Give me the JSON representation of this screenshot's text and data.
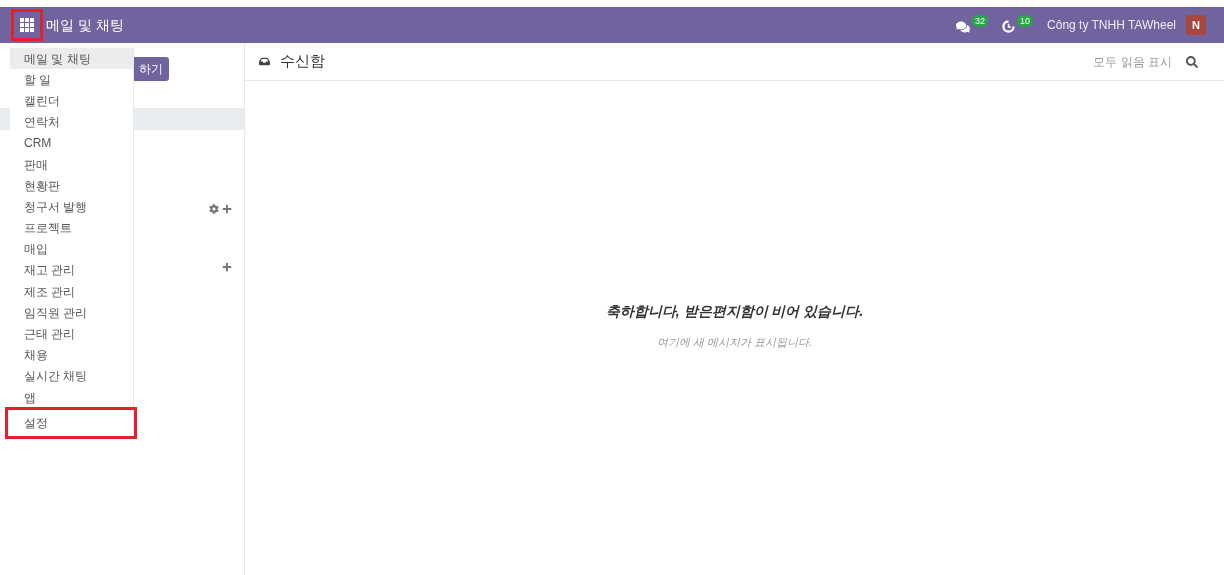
{
  "navbar": {
    "app_title": "메일 및 채팅",
    "apps_button_highlighted": true,
    "messages_count": "32",
    "activities_count": "10",
    "company": "Công ty TNHH TAWheel",
    "avatar_letter": "N"
  },
  "app_menu": [
    {
      "label": "메일 및 채팅",
      "selected": true,
      "highlighted": false
    },
    {
      "label": "할 일",
      "selected": false,
      "highlighted": false
    },
    {
      "label": "캘린더",
      "selected": false,
      "highlighted": false
    },
    {
      "label": "연락처",
      "selected": false,
      "highlighted": false
    },
    {
      "label": "CRM",
      "selected": false,
      "highlighted": false
    },
    {
      "label": "판매",
      "selected": false,
      "highlighted": false
    },
    {
      "label": "현황판",
      "selected": false,
      "highlighted": false
    },
    {
      "label": "청구서 발행",
      "selected": false,
      "highlighted": false
    },
    {
      "label": "프로젝트",
      "selected": false,
      "highlighted": false
    },
    {
      "label": "매입",
      "selected": false,
      "highlighted": false
    },
    {
      "label": "재고 관리",
      "selected": false,
      "highlighted": false
    },
    {
      "label": "제조 관리",
      "selected": false,
      "highlighted": false
    },
    {
      "label": "임직원 관리",
      "selected": false,
      "highlighted": false
    },
    {
      "label": "근태 관리",
      "selected": false,
      "highlighted": false
    },
    {
      "label": "채용",
      "selected": false,
      "highlighted": false
    },
    {
      "label": "실시간 채팅",
      "selected": false,
      "highlighted": false
    },
    {
      "label": "앱",
      "selected": false,
      "highlighted": false
    },
    {
      "label": "설정",
      "selected": false,
      "highlighted": true
    }
  ],
  "sidebar": {
    "compose_button": "하기"
  },
  "inbox": {
    "title": "수신함",
    "mark_all_read": "모두 읽음 표시",
    "empty_title": "축하합니다, 받은편지함이 비어 있습니다.",
    "empty_subtitle": "여기에 새 메시지가 표시됩니다."
  }
}
